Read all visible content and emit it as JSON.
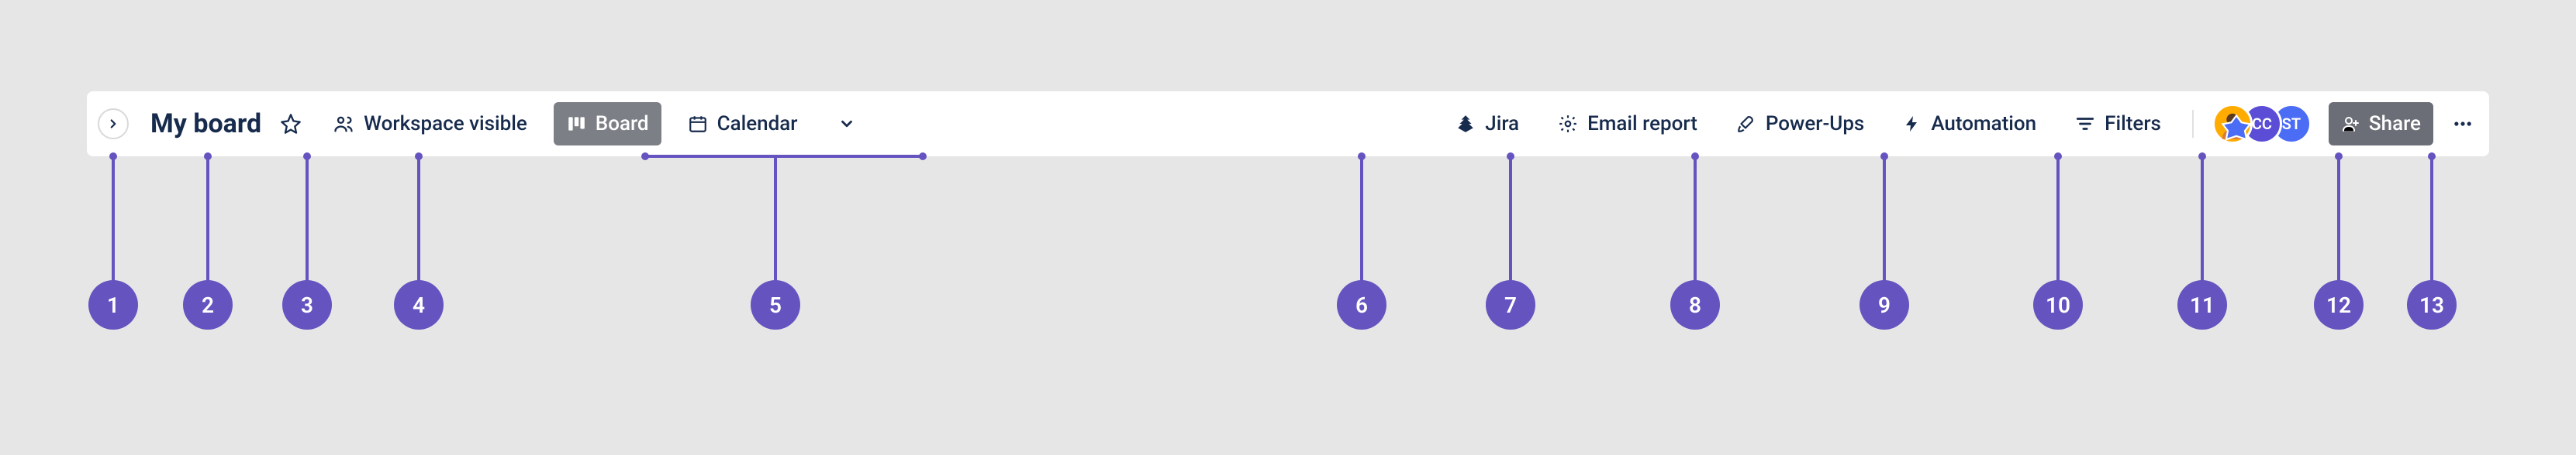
{
  "toolbar": {
    "title": "My board",
    "visibility_label": "Workspace visible",
    "board_label": "Board",
    "calendar_label": "Calendar",
    "jira_label": "Jira",
    "email_report_label": "Email report",
    "powerups_label": "Power-Ups",
    "automation_label": "Automation",
    "filters_label": "Filters",
    "share_label": "Share"
  },
  "avatars": {
    "a2": "CC",
    "a3": "ST"
  },
  "callouts": {
    "c1": "1",
    "c2": "2",
    "c3": "3",
    "c4": "4",
    "c5": "5",
    "c6": "6",
    "c7": "7",
    "c8": "8",
    "c9": "9",
    "c10": "10",
    "c11": "11",
    "c12": "12",
    "c13": "13"
  },
  "colors": {
    "callout": "#6554c0",
    "text": "#172b4d",
    "pill_active_bg": "#7c7f86",
    "share_bg": "#6b6e76"
  }
}
